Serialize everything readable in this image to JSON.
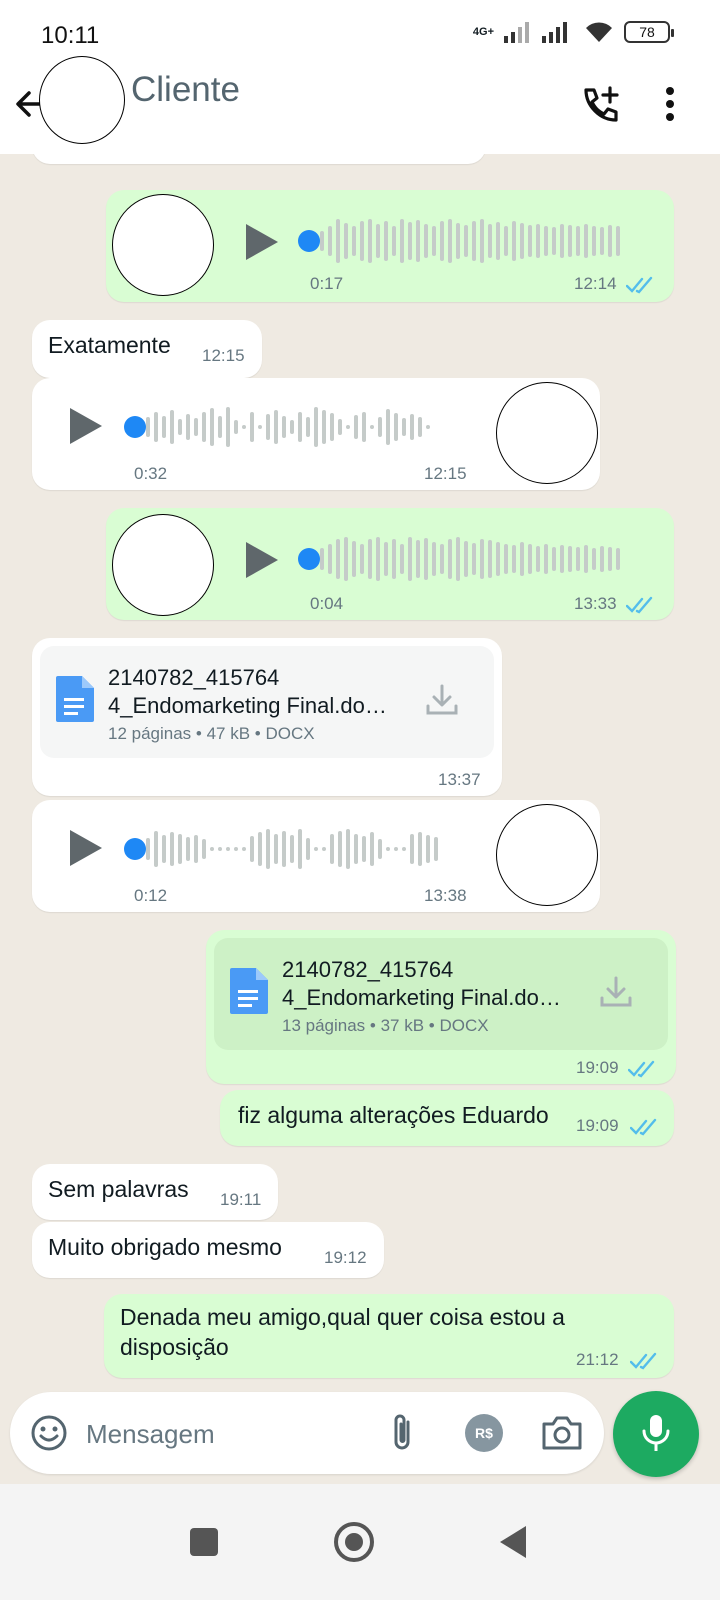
{
  "status_bar": {
    "time": "10:11",
    "network": "4G+",
    "battery": "78"
  },
  "header": {
    "contact_name": "Cliente"
  },
  "messages": [
    {
      "kind": "voice",
      "dir": "out",
      "duration": "0:17",
      "time": "12:14"
    },
    {
      "kind": "text",
      "dir": "in",
      "text": "Exatamente",
      "time": "12:15"
    },
    {
      "kind": "voice",
      "dir": "in",
      "duration": "0:32",
      "time": "12:15"
    },
    {
      "kind": "voice",
      "dir": "out",
      "duration": "0:04",
      "time": "13:33"
    },
    {
      "kind": "document",
      "dir": "in",
      "name_line1": "2140782_415764",
      "name_line2": "4_Endomarketing Final.do…",
      "meta": "12 páginas • 47 kB • DOCX",
      "time": "13:37"
    },
    {
      "kind": "voice",
      "dir": "in",
      "duration": "0:12",
      "time": "13:38"
    },
    {
      "kind": "document",
      "dir": "out",
      "name_line1": "2140782_415764",
      "name_line2": "4_Endomarketing Final.do…",
      "meta": "13 páginas • 37 kB • DOCX",
      "time": "19:09"
    },
    {
      "kind": "text",
      "dir": "out",
      "text": "fiz alguma alterações Eduardo",
      "time": "19:09"
    },
    {
      "kind": "text",
      "dir": "in",
      "text": "Sem palavras",
      "time": "19:11"
    },
    {
      "kind": "text",
      "dir": "in",
      "text": "Muito obrigado mesmo",
      "time": "19:12"
    },
    {
      "kind": "text",
      "dir": "out",
      "text_line1": "Denada meu amigo,qual quer coisa estou a",
      "text_line2": "disposição",
      "time": "21:12"
    }
  ],
  "input": {
    "placeholder": "Mensagem",
    "pay_label": "R$"
  },
  "colors": {
    "outgoing": "#d9fdd3",
    "incoming": "#ffffff",
    "read_ticks": "#53bdeb",
    "accent_green": "#1daa61",
    "voice_dot": "#1e88f5"
  }
}
